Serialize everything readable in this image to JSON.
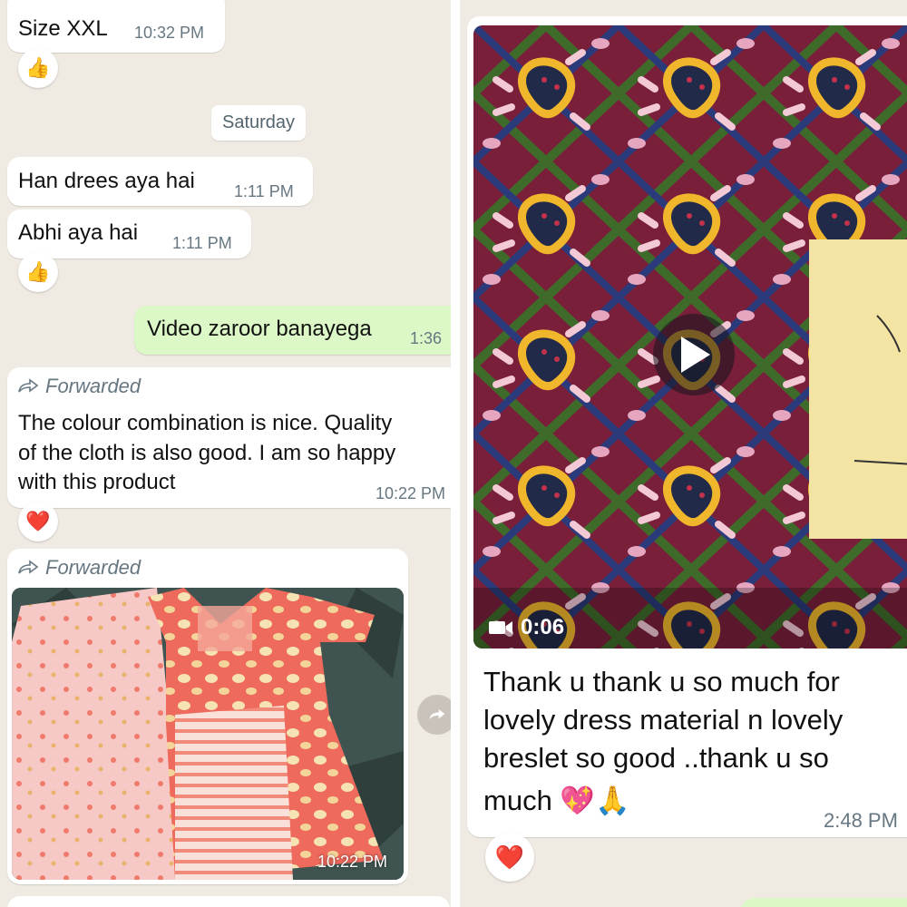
{
  "left": {
    "msg1": {
      "text": "Size XXL",
      "time": "10:32 PM",
      "reaction": "👍"
    },
    "day_divider": "Saturday",
    "msg2": {
      "text": "Han drees aya hai",
      "time": "1:11 PM"
    },
    "msg3": {
      "text": "Abhi aya hai",
      "time": "1:11 PM",
      "reaction": "👍"
    },
    "msg4": {
      "text": "Video zaroor banayega",
      "time": "1:36"
    },
    "msg5": {
      "forwarded_label": "Forwarded",
      "lines": [
        "The colour combination is nice. Quality",
        "of the cloth is also good. I am so happy",
        "with this product"
      ],
      "time": "10:22 PM",
      "reaction": "❤️"
    },
    "msg6": {
      "forwarded_label": "Forwarded",
      "time": "10:22 PM"
    }
  },
  "right": {
    "video": {
      "duration": "0:06"
    },
    "msg": {
      "lines": [
        "Thank u thank u so much for",
        "lovely dress  material n lovely",
        "breslet so good ..thank u so",
        "much 💖🙏"
      ],
      "time": "2:48 PM",
      "reaction": "❤️"
    }
  },
  "colors": {
    "chat_bg": "#efeae2",
    "outgoing_bubble": "#dcf8c6",
    "incoming_bubble": "#ffffff",
    "timestamp": "#667781"
  },
  "icons": {
    "forward": "forward-arrow-icon",
    "play": "play-icon",
    "video": "video-camera-icon",
    "share": "share-forward-icon"
  }
}
